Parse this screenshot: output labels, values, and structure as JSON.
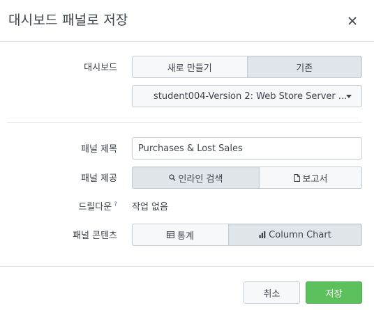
{
  "dialog": {
    "title": "대시보드 패널로 저장",
    "close_icon": "close-icon"
  },
  "form": {
    "dashboard": {
      "label": "대시보드",
      "options": [
        {
          "label": "새로 만들기",
          "selected": false
        },
        {
          "label": "기존",
          "selected": true
        }
      ],
      "select_value": "student004-Version 2: Web Store Server ..."
    },
    "panel_title": {
      "label": "패널 제목",
      "value": "Purchases & Lost Sales"
    },
    "panel_source": {
      "label": "패널 제공",
      "options": [
        {
          "label": "인라인 검색",
          "icon": "search-icon",
          "selected": true
        },
        {
          "label": "보고서",
          "icon": "document-icon",
          "selected": false
        }
      ]
    },
    "drilldown": {
      "label": "드릴다운",
      "help": "?",
      "value": "작업 없음"
    },
    "panel_content": {
      "label": "패널 콘텐츠",
      "options": [
        {
          "label": "통계",
          "icon": "table-icon",
          "selected": false
        },
        {
          "label": "Column Chart",
          "icon": "bar-chart-icon",
          "selected": true
        }
      ]
    }
  },
  "footer": {
    "cancel_label": "취소",
    "save_label": "저장"
  },
  "colors": {
    "accent_green": "#5cc05c",
    "border": "#c3cbd4",
    "text": "#3c444d"
  }
}
